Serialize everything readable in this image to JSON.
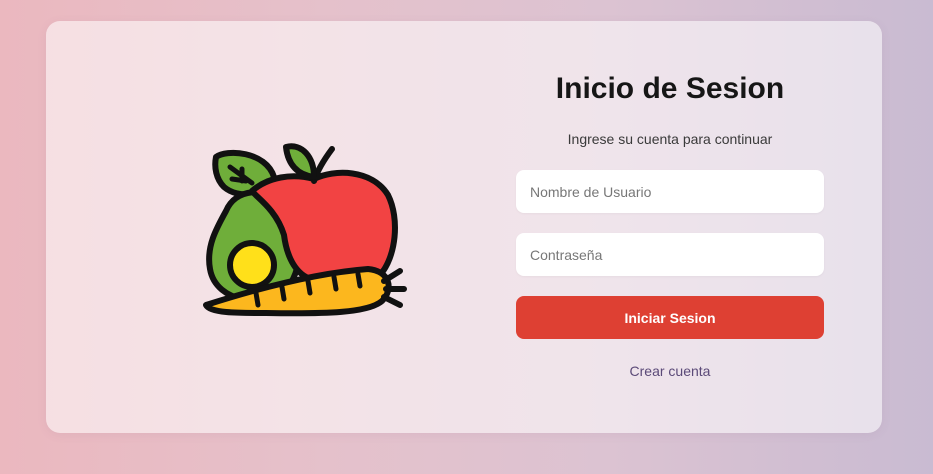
{
  "login": {
    "title": "Inicio de Sesion",
    "subtitle": "Ingrese su cuenta para continuar",
    "username_placeholder": "Nombre de Usuario",
    "password_placeholder": "Contraseña",
    "submit_label": "Iniciar Sesion",
    "create_account_label": "Crear cuenta"
  },
  "illustration": {
    "icon": "fruits-vegetables-icon"
  },
  "colors": {
    "primary": "#de4033",
    "link": "#5b4a78",
    "card": "#f3e9ec"
  }
}
